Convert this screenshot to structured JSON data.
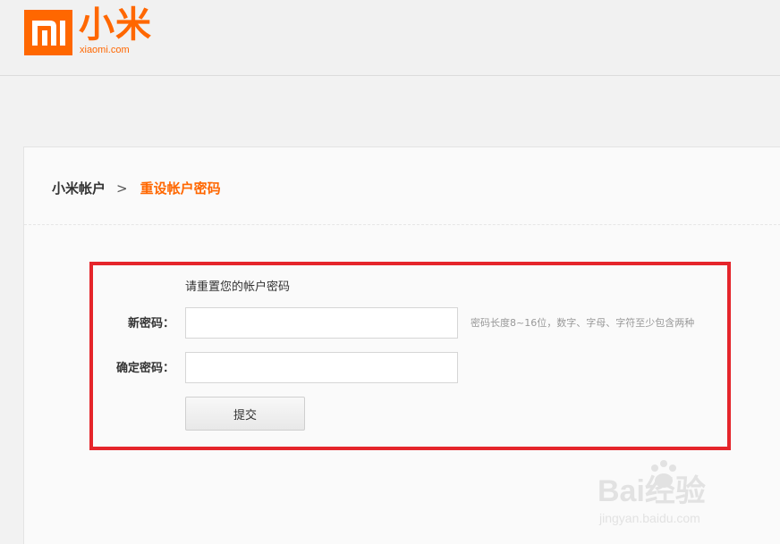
{
  "brand": {
    "name_cn": "小米",
    "domain": "xiaomi.com",
    "accent_color": "#ff6700"
  },
  "breadcrumb": {
    "home": "小米帐户",
    "separator": ">",
    "current": "重设帐户密码"
  },
  "form": {
    "title": "请重置您的帐户密码",
    "new_password_label": "新密码：",
    "new_password_value": "",
    "new_password_hint": "密码长度8~16位，数字、字母、字符至少包含两种",
    "confirm_password_label": "确定密码：",
    "confirm_password_value": "",
    "submit_label": "提交"
  },
  "highlight_color": "#e5252b",
  "watermark": {
    "text": "Bai经验",
    "url": "jingyan.baidu.com"
  }
}
